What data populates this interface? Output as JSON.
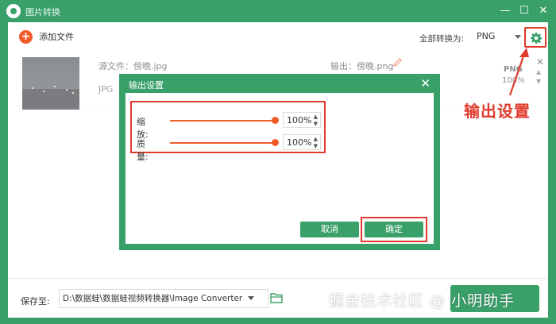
{
  "window": {
    "title": "图片转换",
    "min_glyph": "—",
    "max_glyph": "☐",
    "close_glyph": "✕"
  },
  "toolbar": {
    "add_file_label": "添加文件",
    "add_file_icon": "+",
    "convert_all_label": "全部转换为:",
    "format_value": "PNG"
  },
  "file_item": {
    "source_label": "源文件：傍晚.jpg",
    "source_format": "JPG",
    "output_label": "输出：傍晚.png",
    "output_format": "PNG",
    "quality_pct": "100%",
    "remove_glyph": "✕",
    "up_glyph": "▲",
    "down_glyph": "▼"
  },
  "annotation": {
    "label": "输出设置",
    "color": "#e03a2c"
  },
  "dialog": {
    "title": "输出设置",
    "close_glyph": "✕",
    "scale": {
      "label": "缩放:",
      "value": "100%",
      "level": 1.0
    },
    "quality": {
      "label": "质量:",
      "value": "100%",
      "level": 1.0
    },
    "step_up": "▲",
    "step_down": "▼",
    "cancel_label": "取消",
    "ok_label": "确定"
  },
  "bottom": {
    "save_label": "保存至:",
    "save_path": "D:\\数据蛙\\数据蛙视频转换器\\Image Converter"
  },
  "watermark": "掘金技术社区 @ 小明助手",
  "colors": {
    "accent": "#3aa06a",
    "orange": "#f05a28",
    "highlight": "#e03a2c"
  }
}
